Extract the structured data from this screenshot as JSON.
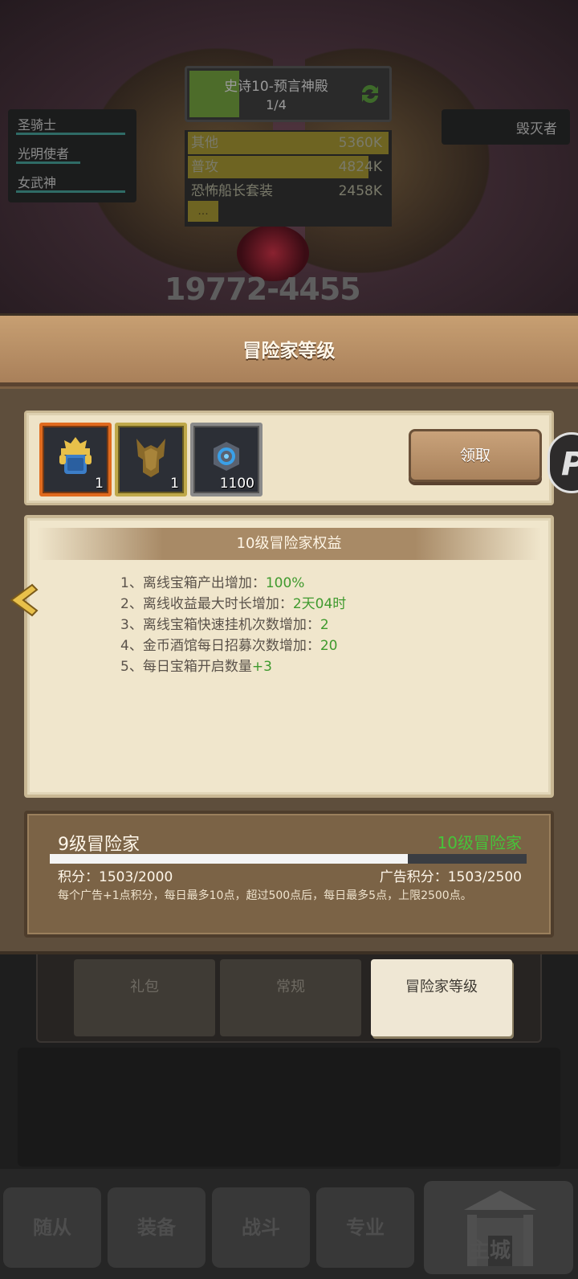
{
  "battle": {
    "stage_name": "史诗10-预言神殿",
    "stage_progress": "1/4",
    "stage_progress_fraction": 0.25,
    "damage_rows": [
      {
        "label": "其他",
        "value": "5360K",
        "fraction": 1.0
      },
      {
        "label": "普攻",
        "value": "4824K",
        "fraction": 0.9
      },
      {
        "label": "恐怖船长套装",
        "value": "2458K",
        "fraction": 0.0
      }
    ],
    "damage_more": "...",
    "team": [
      {
        "name": "圣骑士",
        "hp": 1.0
      },
      {
        "name": "光明使者",
        "hp": 0.55
      },
      {
        "name": "女武神",
        "hp": 1.0
      }
    ],
    "enemy": "毁灭者",
    "boss_damage": "19772-4455"
  },
  "modal": {
    "title": "冒险家等级",
    "rewards": [
      {
        "icon": "helmet-icon",
        "count": "1",
        "rarity_color": "#e06a1e"
      },
      {
        "icon": "armor-icon",
        "count": "1",
        "rarity_color": "#bfa84a"
      },
      {
        "icon": "rune-stone-icon",
        "count": "1100",
        "rarity_color": "#8a8a8a"
      }
    ],
    "claim_label": "领取",
    "side_disc_letter": "P",
    "benefits_title": "10级冒险家权益",
    "benefits": [
      {
        "text": "1、离线宝箱产出增加：",
        "value": "100%"
      },
      {
        "text": "2、离线收益最大时长增加：",
        "value": "2天04时"
      },
      {
        "text": "3、离线宝箱快速挂机次数增加：",
        "value": "2"
      },
      {
        "text": "4、金币酒馆每日招募次数增加：",
        "value": "20"
      },
      {
        "text": "5、每日宝箱开启数量",
        "value": "+3"
      }
    ],
    "current_level": "9级冒险家",
    "next_level": "10级冒险家",
    "progress_fraction": 0.7515,
    "score_text": "积分：1503/2000",
    "ad_score_text": "广告积分：1503/2500",
    "note": "每个广告+1点积分，每日最多10点，超过500点后，每日最多5点，上限2500点。"
  },
  "sub_tabs": [
    {
      "label": "礼包",
      "active": false
    },
    {
      "label": "常规",
      "active": false
    },
    {
      "label": "冒险家等级",
      "active": true
    }
  ],
  "bottom_nav": [
    {
      "label": "随从"
    },
    {
      "label": "装备"
    },
    {
      "label": "战斗"
    },
    {
      "label": "专业"
    },
    {
      "label": "主城"
    }
  ],
  "colors": {
    "accent_green": "#3f9a2e",
    "next_level_green": "#46c43a",
    "modal_header": "#b88e64"
  }
}
